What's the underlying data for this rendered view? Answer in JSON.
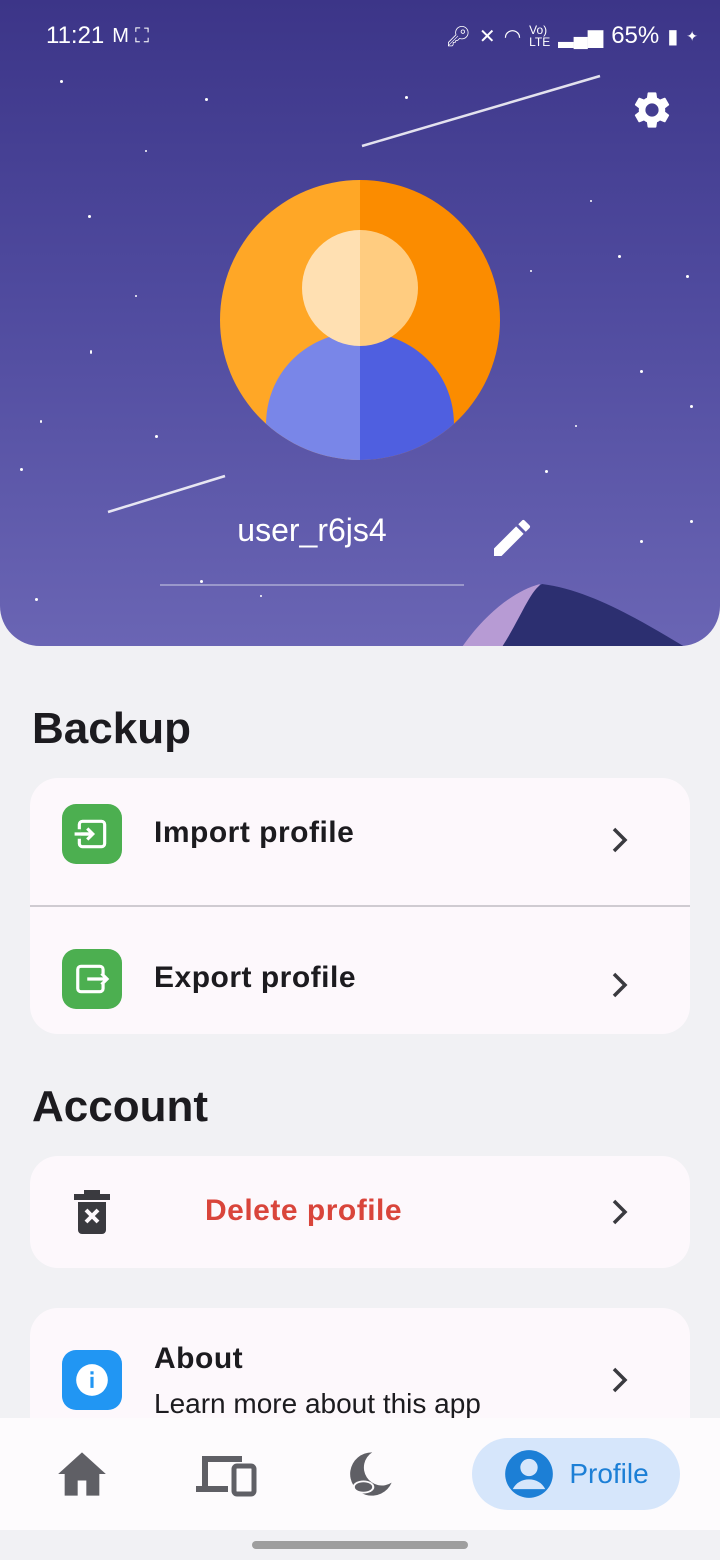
{
  "status_bar": {
    "time": "11:21",
    "battery": "65%",
    "left_icons": [
      "gmail-icon",
      "screenshot-icon"
    ],
    "right_icons": [
      "key-icon",
      "mute-icon",
      "wifi-icon",
      "volte-icon",
      "signal-icon",
      "battery-icon"
    ]
  },
  "header": {
    "username": "user_r6js4",
    "colors": {
      "gradient_top": "#3c3588",
      "gradient_bottom": "#6a65b4"
    }
  },
  "backup": {
    "title": "Backup",
    "items": [
      {
        "label": "Import profile",
        "icon": "import-icon",
        "icon_bg": "#4caf50"
      },
      {
        "label": "Export profile",
        "icon": "export-icon",
        "icon_bg": "#4caf50"
      }
    ]
  },
  "account": {
    "title": "Account",
    "items": [
      {
        "label": "Delete profile",
        "icon": "trash-icon",
        "color": "#d9453b"
      }
    ]
  },
  "about": {
    "label": "About",
    "subtitle": "Learn more about this app",
    "icon": "info-icon",
    "icon_bg": "#2196f3"
  },
  "bottom_nav": {
    "items": [
      {
        "icon": "home-icon"
      },
      {
        "icon": "devices-icon"
      },
      {
        "icon": "sleep-icon"
      },
      {
        "icon": "profile-icon",
        "label": "Profile",
        "active": true
      }
    ]
  }
}
